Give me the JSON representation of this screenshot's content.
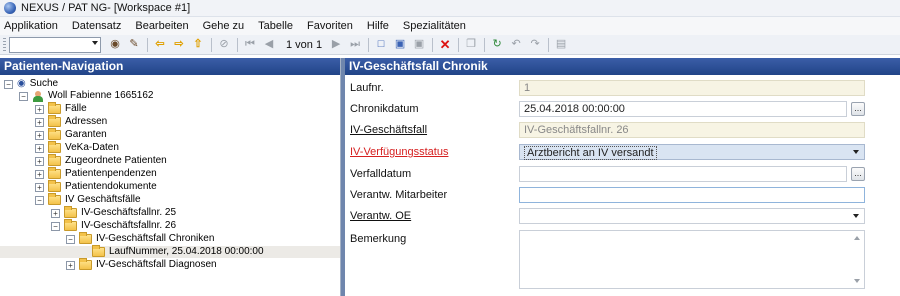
{
  "window": {
    "title": "NEXUS / PAT NG- [Workspace #1]"
  },
  "menu": [
    "Applikation",
    "Datensatz",
    "Bearbeiten",
    "Gehe zu",
    "Tabelle",
    "Favoriten",
    "Hilfe",
    "Spezialitäten"
  ],
  "toolbar": {
    "search_value": "",
    "pager_text": "1 von 1"
  },
  "nav": {
    "title": "Patienten-Navigation",
    "items": [
      {
        "label": "Suche"
      },
      {
        "label": "Woll Fabienne 1665162"
      },
      {
        "label": "Fälle"
      },
      {
        "label": "Adressen"
      },
      {
        "label": "Garanten"
      },
      {
        "label": "VeKa-Daten"
      },
      {
        "label": "Zugeordnete Patienten"
      },
      {
        "label": "Patientenpendenzen"
      },
      {
        "label": "Patientendokumente"
      },
      {
        "label": "IV Geschäftsfälle"
      },
      {
        "label": "IV-Geschäftsfallnr. 25"
      },
      {
        "label": "IV-Geschäftsfallnr. 26"
      },
      {
        "label": "IV-Geschäftsfall Chroniken"
      },
      {
        "label": "LaufNummer, 25.04.2018 00:00:00"
      },
      {
        "label": "IV-Geschäftsfall Diagnosen"
      }
    ]
  },
  "detail": {
    "title": "IV-Geschäftsfall Chronik",
    "fields": {
      "laufnr": {
        "label": "Laufnr.",
        "value": "1"
      },
      "chronikdatum": {
        "label": "Chronikdatum",
        "value": "25.04.2018 00:00:00"
      },
      "geschaeftsfall": {
        "label": "IV-Geschäftsfall",
        "value": "IV-Geschäftsfallnr. 26"
      },
      "verfuegungsstatus": {
        "label": "IV-Verfügungsstatus",
        "value": "Arztbericht an IV versandt"
      },
      "verfalldatum": {
        "label": "Verfalldatum",
        "value": ""
      },
      "mitarbeiter": {
        "label": "Verantw. Mitarbeiter",
        "value": ""
      },
      "oe": {
        "label": "Verantw. OE",
        "value": ""
      },
      "bemerkung": {
        "label": "Bemerkung",
        "value": ""
      }
    }
  }
}
